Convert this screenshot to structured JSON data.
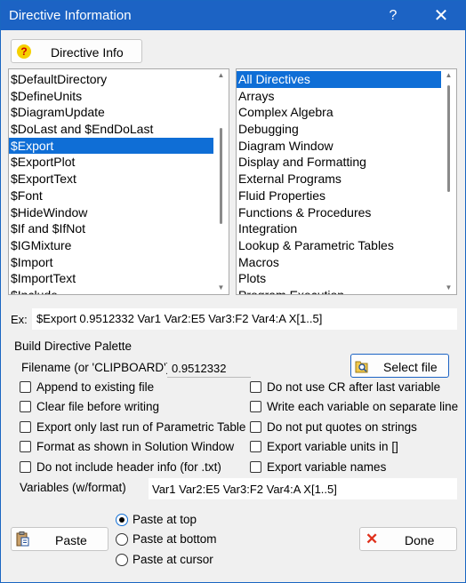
{
  "window": {
    "title": "Directive Information",
    "help_glyph": "?",
    "close_glyph": "✕"
  },
  "toolbar": {
    "directive_info_label": "Directive Info",
    "help_icon_glyph": "?"
  },
  "directives_list": {
    "items": [
      "$DefaultDirectory",
      "$DefineUnits",
      "$DiagramUpdate",
      "$DoLast and $EndDoLast",
      "$Export",
      "$ExportPlot",
      "$ExportText",
      "$Font",
      "$HideWindow",
      "$If and $IfNot",
      "$IGMixture",
      "$Import",
      "$ImportText",
      "$Include"
    ],
    "selected": "$Export"
  },
  "categories_list": {
    "items": [
      "All Directives",
      "Arrays",
      "Complex Algebra",
      "Debugging",
      "Diagram Window",
      "Display and Formatting",
      "External Programs",
      "Fluid Properties",
      "Functions & Procedures",
      "Integration",
      "Lookup & Parametric Tables",
      "Macros",
      "Plots",
      "Program Execution"
    ],
    "selected": "All Directives"
  },
  "example": {
    "label": "Ex:",
    "value": "$Export 0.9512332 Var1  Var2:E5  Var3:F2  Var4:A  X[1..5]"
  },
  "palette": {
    "heading": "Build Directive Palette",
    "filename_label": "Filename (or 'CLIPBOARD'):",
    "filename_value": "0.9512332",
    "select_file_label": "Select file",
    "checkboxes_left": [
      "Append to existing file",
      "Clear file before writing",
      "Export only last run of Parametric Table",
      "Format as shown in Solution Window",
      "Do not include header info (for .txt)"
    ],
    "checkboxes_right": [
      "Do not use CR after last variable",
      "Write each variable on separate line",
      "Do not put quotes on strings",
      "Export variable units in []",
      "Export variable names"
    ],
    "variables_label": "Variables (w/format)",
    "variables_value": "Var1  Var2:E5  Var3:F2  Var4:A  X[1..5]"
  },
  "bottom": {
    "paste_label": "Paste",
    "radio_options": [
      "Paste at top",
      "Paste at bottom",
      "Paste at cursor"
    ],
    "radio_selected": "Paste at top",
    "done_label": "Done",
    "done_icon_glyph": "✕"
  },
  "colors": {
    "titlebar": "#1c63c4",
    "selection": "#0f6ed6",
    "done_x": "#e0311c",
    "help_badge": "#f5d000"
  }
}
